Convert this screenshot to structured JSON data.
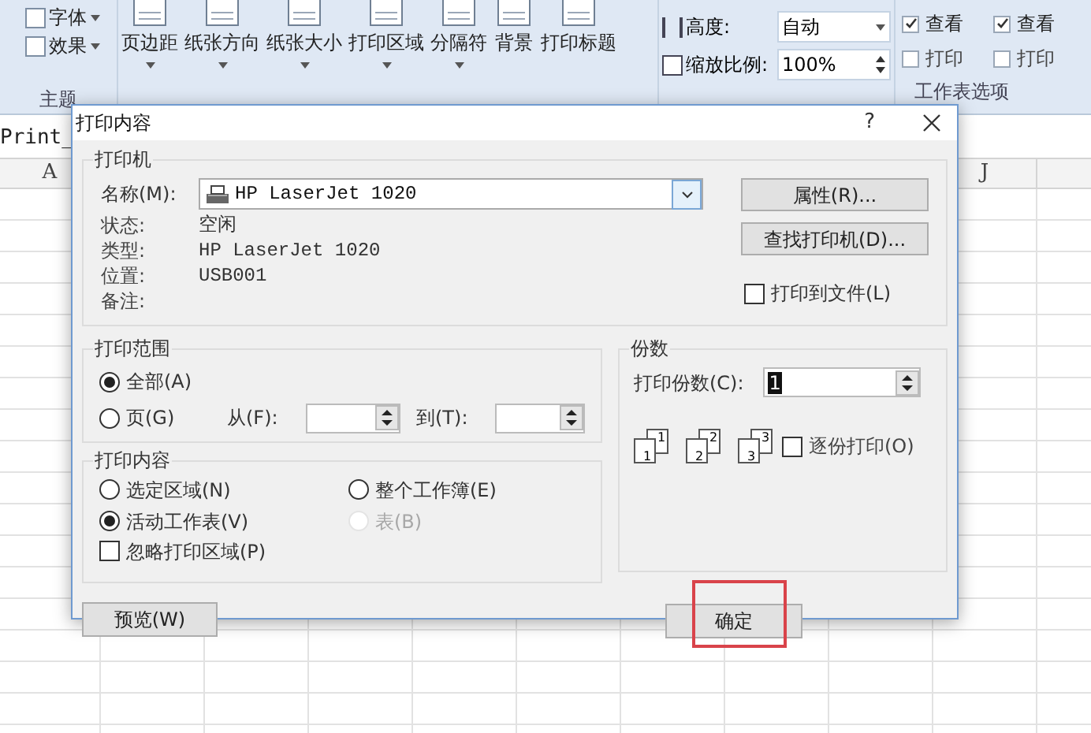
{
  "ribbon": {
    "theme_group": {
      "items": [
        "字体",
        "效果"
      ],
      "label": "主题"
    },
    "page_setup": [
      "页边距",
      "纸张方向",
      "纸张大小",
      "打印区域",
      "分隔符",
      "背景",
      "打印标题"
    ],
    "scale": {
      "height_label": "高度:",
      "height_value": "自动",
      "zoom_label": "缩放比例:",
      "zoom_value": "100%"
    },
    "sheet_options": {
      "label": "工作表选项",
      "columns": [
        [
          {
            "label": "查看",
            "checked": true
          },
          {
            "label": "打印",
            "checked": false
          }
        ],
        [
          {
            "label": "查看",
            "checked": true
          },
          {
            "label": "打印",
            "checked": false
          }
        ]
      ]
    }
  },
  "name_box": "Print_",
  "column_headers": {
    "left": "A",
    "right": "J"
  },
  "dialog": {
    "title": "打印内容",
    "help": "?",
    "printer": {
      "legend": "打印机",
      "name_label": "名称(M):",
      "name_value": "HP LaserJet 1020",
      "info": [
        {
          "label": "状态:",
          "value": "空闲"
        },
        {
          "label": "类型:",
          "value": "HP LaserJet 1020"
        },
        {
          "label": "位置:",
          "value": "USB001"
        },
        {
          "label": "备注:"
        }
      ],
      "buttons": [
        "属性(R)...",
        "查找打印机(D)..."
      ],
      "to_file": {
        "label": "打印到文件(L)",
        "checked": false
      }
    },
    "range": {
      "legend": "打印范围",
      "options": [
        {
          "label": "全部(A)",
          "selected": true
        },
        {
          "label": "页(G)",
          "selected": false
        }
      ],
      "from_label": "从(F):",
      "to_label": "到(T):"
    },
    "copies": {
      "legend": "份数",
      "count_label": "打印份数(C):",
      "count_value": "1",
      "collate_pages": [
        {
          "back": "1",
          "front": "1"
        },
        {
          "back": "2",
          "front": "2"
        },
        {
          "back": "3",
          "front": "3"
        }
      ],
      "collate": {
        "label": "逐份打印(O)",
        "checked": false
      }
    },
    "content": {
      "legend": "打印内容",
      "options": [
        {
          "label": "选定区域(N)",
          "selected": false,
          "disabled": false
        },
        {
          "label": "整个工作簿(E)",
          "selected": false,
          "disabled": false
        },
        {
          "label": "活动工作表(V)",
          "selected": true,
          "disabled": false
        },
        {
          "label": "表(B)",
          "selected": false,
          "disabled": true
        }
      ],
      "ignore_area": {
        "label": "忽略打印区域(P)",
        "checked": false
      }
    },
    "preview_button": "预览(W)",
    "ok_button": "确定",
    "ok_highlighted": true
  }
}
